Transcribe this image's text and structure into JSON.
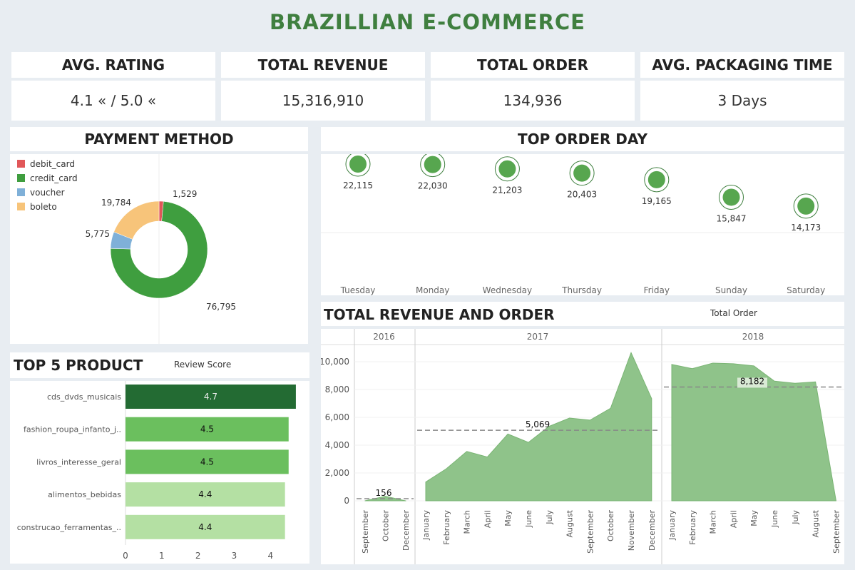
{
  "dashboard": {
    "title": "BRAZILLIAN E-COMMERCE"
  },
  "kpis": [
    {
      "label": "AVG. RATING",
      "value": "4.1 « / 5.0 «"
    },
    {
      "label": "TOTAL REVENUE",
      "value": "15,316,910"
    },
    {
      "label": "TOTAL ORDER",
      "value": "134,936"
    },
    {
      "label": "AVG. PACKAGING TIME",
      "value": "3 Days"
    }
  ],
  "panels": {
    "payment": "PAYMENT METHOD",
    "top_day": "TOP ORDER DAY",
    "top_product": "TOP 5 PRODUCT",
    "top_product_sub": "Review Score",
    "revenue_order": "TOTAL REVENUE AND ORDER",
    "revenue_order_sub": "Total Order"
  },
  "colors": {
    "accent": "#3f7f3f",
    "debit": "#e15759",
    "credit": "#3f9e3f",
    "voucher": "#7fb0d8",
    "boleto": "#f7c47a",
    "area": "#8fc38a"
  },
  "chart_data": [
    {
      "type": "pie",
      "categories": [
        "debit_card",
        "credit_card",
        "voucher",
        "boleto"
      ],
      "values": [
        1529,
        76795,
        5775,
        19784
      ],
      "labels": [
        "1,529",
        "76,795",
        "5,775",
        "19,784"
      ],
      "legend": "top-left"
    },
    {
      "type": "scatter",
      "categories": [
        "Tuesday",
        "Monday",
        "Wednesday",
        "Thursday",
        "Friday",
        "Sunday",
        "Saturday"
      ],
      "values": [
        22115,
        22030,
        21203,
        20403,
        19165,
        15847,
        14173
      ],
      "labels": [
        "22,115",
        "22,030",
        "21,203",
        "20,403",
        "19,165",
        "15,847",
        "14,173"
      ],
      "ylim": [
        0,
        24000
      ]
    },
    {
      "type": "bar",
      "categories": [
        "cds_dvds_musicais",
        "fashion_roupa_infanto_j..",
        "livros_interesse_geral",
        "alimentos_bebidas",
        "construcao_ferramentas_.."
      ],
      "values": [
        4.7,
        4.5,
        4.5,
        4.4,
        4.4
      ],
      "labels": [
        "4.7",
        "4.5",
        "4.5",
        "4.4",
        "4.4"
      ],
      "xticks": [
        "0",
        "1",
        "2",
        "3",
        "4"
      ],
      "xlim": [
        0,
        4.8
      ]
    },
    {
      "type": "area",
      "yticks": [
        "0",
        "2,000",
        "4,000",
        "6,000",
        "8,000",
        "10,000"
      ],
      "ylim": [
        0,
        11000
      ],
      "panels": [
        {
          "year": "2016",
          "months": [
            "September",
            "October",
            "December"
          ],
          "values": [
            4,
            324,
            1
          ],
          "avg": 156,
          "avg_label": "156"
        },
        {
          "year": "2017",
          "months": [
            "January",
            "February",
            "March",
            "April",
            "May",
            "June",
            "July",
            "August",
            "September",
            "October",
            "November",
            "December"
          ],
          "values": [
            1350,
            2300,
            3550,
            3150,
            4800,
            4200,
            5350,
            5950,
            5800,
            6650,
            10650,
            7350
          ],
          "avg": 5069,
          "avg_label": "5,069"
        },
        {
          "year": "2018",
          "months": [
            "January",
            "February",
            "March",
            "April",
            "May",
            "June",
            "July",
            "August",
            "September"
          ],
          "values": [
            9800,
            9500,
            9900,
            9850,
            9700,
            8600,
            8450,
            8550,
            16
          ],
          "avg": 8182,
          "avg_label": "8,182"
        }
      ]
    }
  ]
}
